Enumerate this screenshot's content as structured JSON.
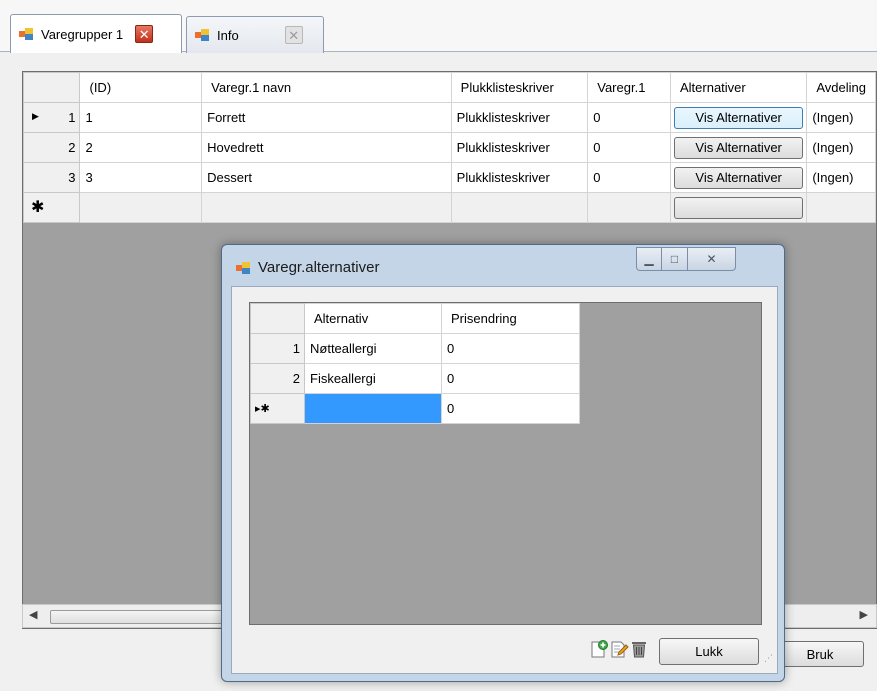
{
  "tabs": [
    {
      "label": "Varegrupper 1",
      "active": true
    },
    {
      "label": "Info",
      "active": false
    }
  ],
  "main_grid": {
    "columns": [
      "(ID)",
      "Varegr.1 navn",
      "Plukklisteskriver",
      "Varegr.1",
      "Alternativer",
      "Avdeling"
    ],
    "rows": [
      {
        "num": "1",
        "id": "1",
        "name": "Forrett",
        "printer": "Plukklisteskriver",
        "varegr": "0",
        "button": "Vis Alternativer",
        "avdeling": "(Ingen)"
      },
      {
        "num": "2",
        "id": "2",
        "name": "Hovedrett",
        "printer": "Plukklisteskriver",
        "varegr": "0",
        "button": "Vis Alternativer",
        "avdeling": "(Ingen)"
      },
      {
        "num": "3",
        "id": "3",
        "name": "Dessert",
        "printer": "Plukklisteskriver",
        "varegr": "0",
        "button": "Vis Alternativer",
        "avdeling": "(Ingen)"
      }
    ],
    "new_row_marker": "✱",
    "current_row_marker": "▶"
  },
  "buttons": {
    "bruk": "Bruk"
  },
  "dialog": {
    "title": "Varegr.alternativer",
    "columns": [
      "Alternativ",
      "Prisendring"
    ],
    "rows": [
      {
        "num": "1",
        "alternativ": "Nøtteallergi",
        "pris": "0"
      },
      {
        "num": "2",
        "alternativ": "Fiskeallergi",
        "pris": "0"
      }
    ],
    "new_row": {
      "marker": "▸✱",
      "alternativ": "",
      "pris": "0"
    },
    "close_label": "Lukk"
  },
  "colors": {
    "selection": "#3399ff",
    "grid_background": "#a0a0a0",
    "close_tab": "#c1301b"
  }
}
